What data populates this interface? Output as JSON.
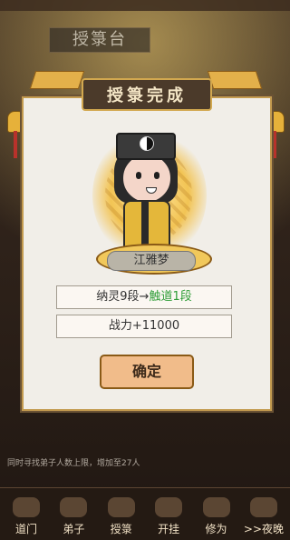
{
  "title": "授箓完成",
  "background_title": "授箓台",
  "character": {
    "name": "江雅梦"
  },
  "rows": {
    "rank": {
      "prefix": "纳灵9段",
      "arrow": "→",
      "result": "触道1段"
    },
    "power": "战力+11000"
  },
  "confirm_label": "确定",
  "footer_text": "同时寻找弟子人数上限，增加至27人",
  "nav": [
    {
      "label": "道门"
    },
    {
      "label": "弟子"
    },
    {
      "label": "授箓"
    },
    {
      "label": "开挂"
    },
    {
      "label": "修为"
    },
    {
      "label": ">>夜晚"
    }
  ],
  "colors": {
    "accent": "#e3b04a",
    "green": "#2e9d37",
    "panel": "#f1eee8"
  },
  "icons": [
    "taiji-icon",
    "bell-icon",
    "tassel-icon",
    "ribbon-icon"
  ]
}
